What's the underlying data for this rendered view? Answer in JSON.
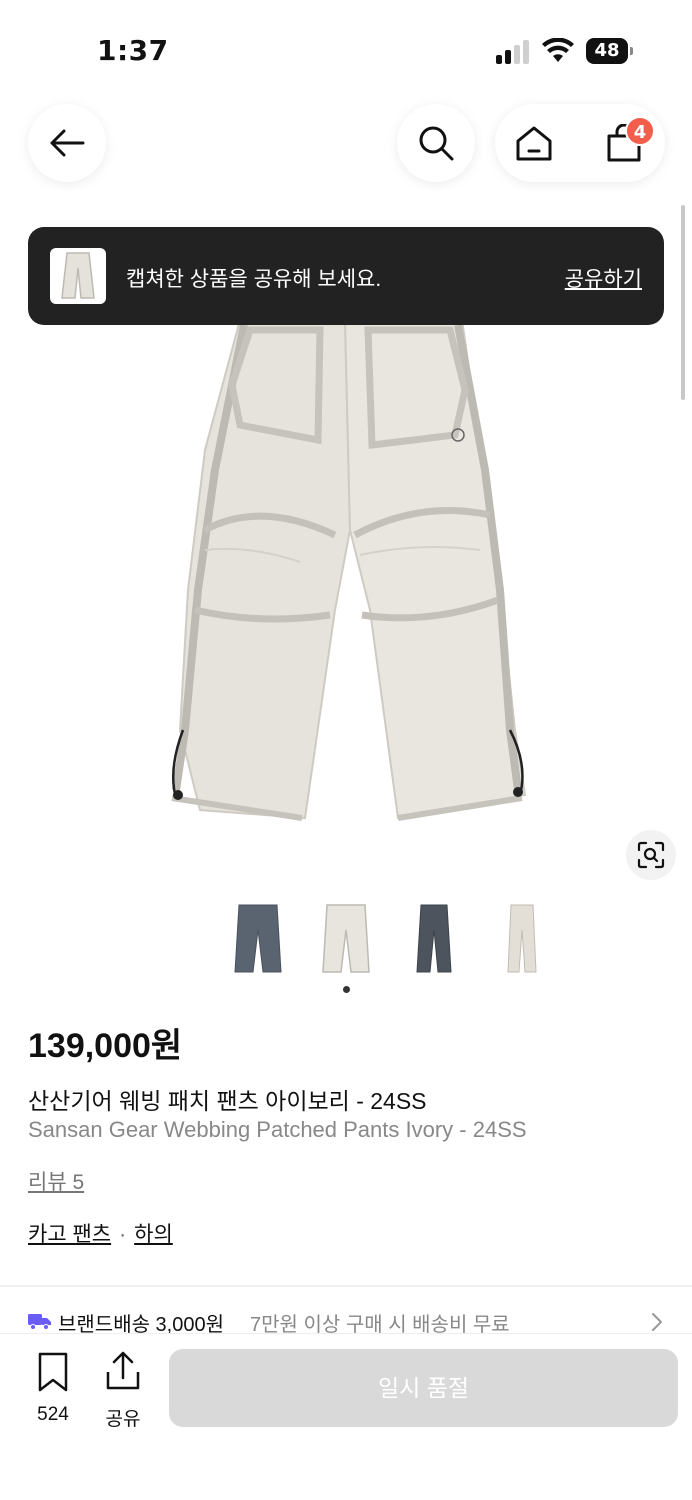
{
  "status_bar": {
    "time": "1:37",
    "battery": "48",
    "icons": [
      "signal-icon",
      "wifi-icon",
      "battery-icon"
    ]
  },
  "header": {
    "back_icon": "arrow-left-icon",
    "search_icon": "search-icon",
    "home_icon": "home-icon",
    "cart_icon": "shopping-bag-icon",
    "cart_count": "4"
  },
  "toast": {
    "message": "캡쳐한 상품을 공유해 보세요.",
    "action": "공유하기"
  },
  "gallery": {
    "lens_icon": "visual-search-icon",
    "thumbnails": [
      "charcoal-pants",
      "ivory-pants",
      "dark-grey-pants",
      "light-beige-pants"
    ],
    "active_index": 1
  },
  "product": {
    "price": "139,000원",
    "name_ko": "산산기어 웨빙 패치 팬츠 아이보리 - 24SS",
    "name_en": "Sansan Gear Webbing Patched Pants Ivory - 24SS",
    "review": "리뷰 5",
    "category_1": "카고 팬츠",
    "category_sep": "·",
    "category_2": "하의"
  },
  "shipping": {
    "label": "브랜드배송 3,000원",
    "note": "7만원 이상 구매 시 배송비 무료",
    "icon": "truck-icon"
  },
  "bottom_bar": {
    "bookmark_count": "524",
    "share_label": "공유",
    "cta_label": "일시 품절"
  },
  "colors": {
    "badge": "#f25d4c",
    "toast_bg": "#222222",
    "soldout_bg": "#d9d9d9",
    "truck": "#6b5cf6"
  }
}
